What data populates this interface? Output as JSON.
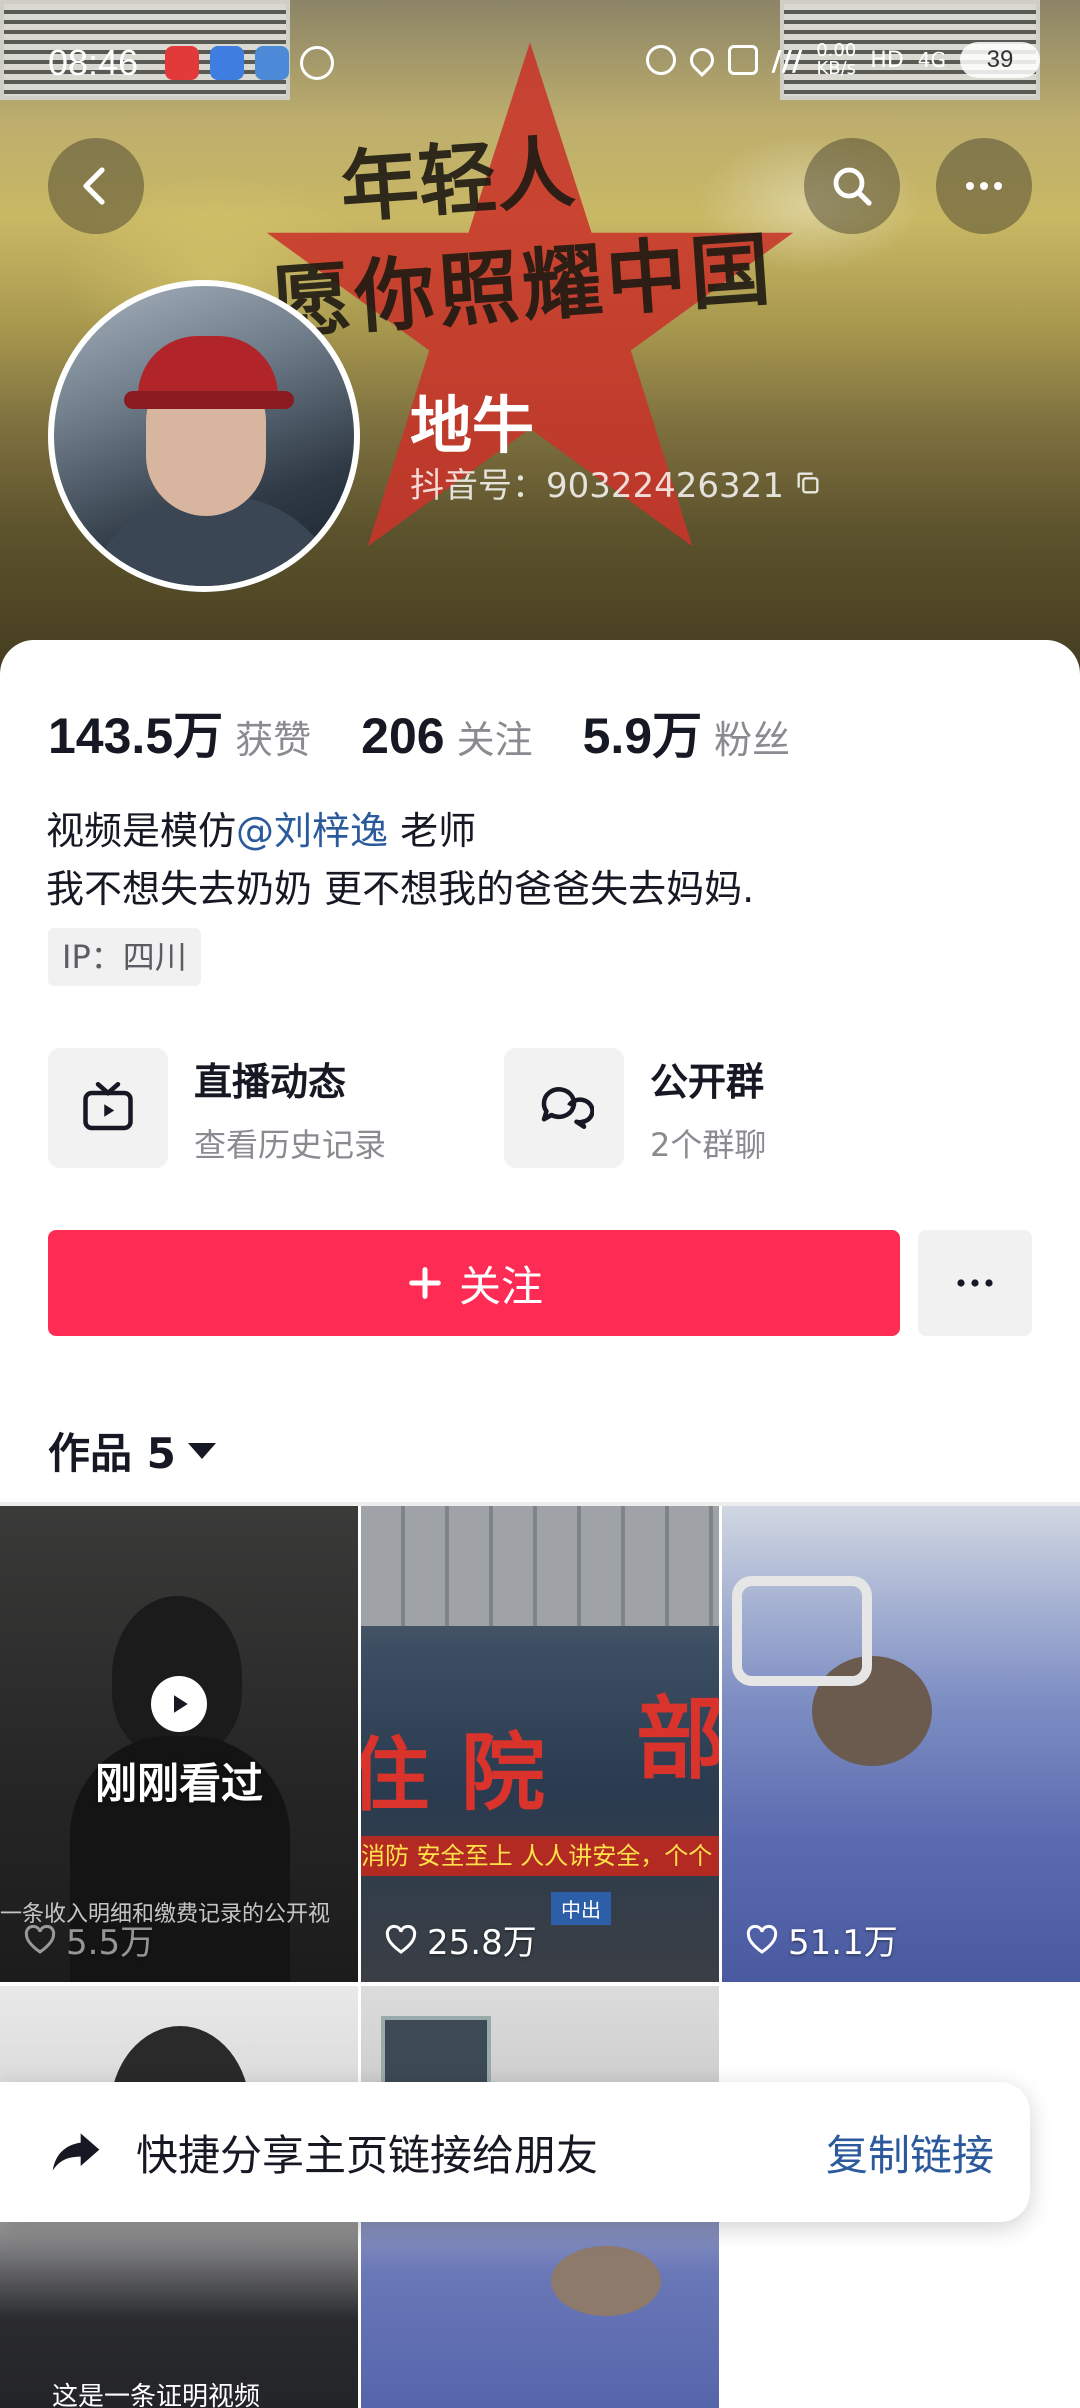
{
  "status_bar": {
    "time": "08:46",
    "net_speed": "0.00\nKB/s",
    "network": "4G",
    "battery": "39"
  },
  "header": {
    "back_icon": "chevron-left-icon",
    "search_icon": "search-icon",
    "more_icon": "more-horizontal-icon",
    "banner_text_line1": "年轻人",
    "banner_text_line2": "愿你照耀中国"
  },
  "profile": {
    "name": "地牛",
    "douyin_id": "抖音号：90322426321"
  },
  "stats": [
    {
      "value": "143.5万",
      "label": "获赞"
    },
    {
      "value": "206",
      "label": "关注"
    },
    {
      "value": "5.9万",
      "label": "粉丝"
    }
  ],
  "bio": {
    "line1_prefix": "视频是模仿",
    "line1_mention": "@刘梓逸",
    "line1_suffix": " 老师",
    "line2": "我不想失去奶奶 更不想我的爸爸失去妈妈."
  },
  "ip": "IP：四川",
  "features": [
    {
      "title": "直播动态",
      "subtitle": "查看历史记录",
      "icon": "tv-icon"
    },
    {
      "title": "公开群",
      "subtitle": "2个群聊",
      "icon": "chat-bubbles-icon"
    }
  ],
  "actions": {
    "follow_label": "关注",
    "more_label": "···"
  },
  "works_tab": {
    "label": "作品 5"
  },
  "videos": [
    {
      "likes": "5.5万",
      "overlay": "刚刚看过",
      "caption": "一条收入明细和缴费记录的公开视"
    },
    {
      "likes": "25.8万",
      "sign_a": "院",
      "sign_b": "部",
      "sign_c": "住",
      "banner": "消防 安全至上 人人讲安全，个个",
      "sub": "中出"
    },
    {
      "likes": "51.1万"
    },
    {
      "likes": ""
    },
    {
      "likes": ""
    }
  ],
  "share_bar": {
    "text": "快捷分享主页链接给朋友",
    "link": "复制链接"
  },
  "bottom_caption": "这是一条证明视频",
  "colors": {
    "accent": "#fe2c55",
    "link": "#2b5a9c",
    "muted": "#8a8b91"
  }
}
